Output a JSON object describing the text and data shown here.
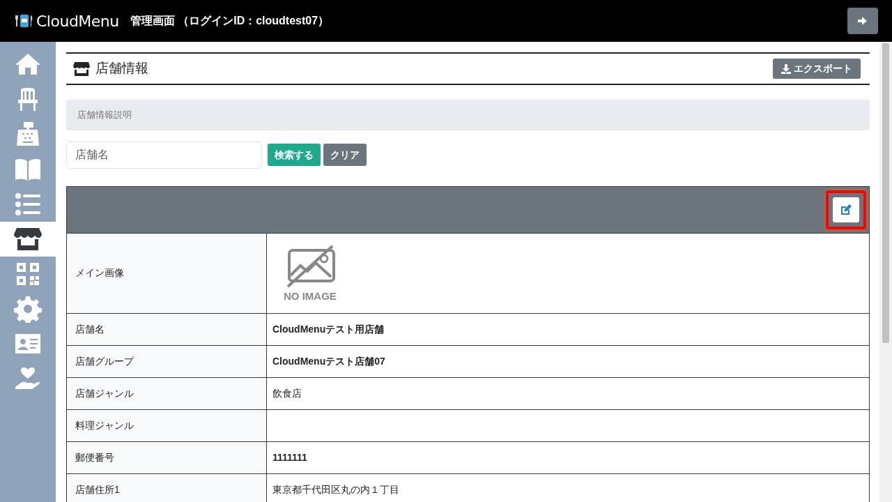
{
  "header": {
    "logo": "CloudMenu",
    "title": "管理画面 （ログインID：cloudtest07）"
  },
  "sidebar": {
    "items": [
      {
        "selected": false
      },
      {
        "selected": false
      },
      {
        "selected": false
      },
      {
        "selected": false
      },
      {
        "selected": false
      },
      {
        "selected": true
      },
      {
        "selected": false
      },
      {
        "selected": false
      },
      {
        "selected": false
      },
      {
        "selected": false
      }
    ]
  },
  "page": {
    "title": "店舗情報",
    "export_button": "エクスポート",
    "description": "店舗情報説明"
  },
  "search": {
    "placeholder": "店舗名",
    "search_button": "検索する",
    "clear_button": "クリア"
  },
  "detail": {
    "edit_highlighted": true,
    "image_label": "メイン画像",
    "image_placeholder": "NO IMAGE",
    "rows": [
      {
        "label": "店舗名",
        "value": "CloudMenuテスト用店舗",
        "bold": true
      },
      {
        "label": "店舗グループ",
        "value": "CloudMenuテスト店舗07",
        "bold": true
      },
      {
        "label": "店舗ジャンル",
        "value": "飲食店",
        "bold": false
      },
      {
        "label": "料理ジャンル"
      },
      {
        "label": "郵便番号",
        "value": "1111111",
        "bold": true
      },
      {
        "label": "店舗住所1",
        "value": "東京都千代田区丸の内１丁目",
        "bold": false
      }
    ]
  }
}
